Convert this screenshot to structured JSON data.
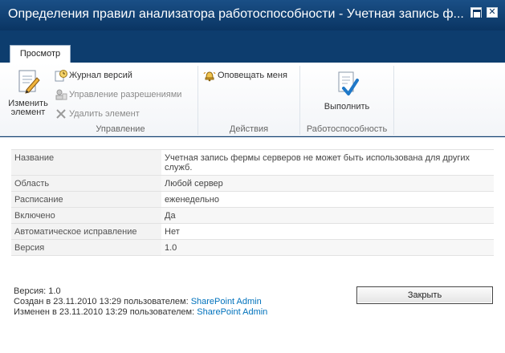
{
  "window": {
    "title": "Определения правил анализатора работоспособности - Учетная запись ф..."
  },
  "ribbon": {
    "tab_label": "Просмотр",
    "groups": {
      "manage": {
        "label": "Управление",
        "edit_item": "Изменить элемент",
        "version_history": "Журнал версий",
        "manage_permissions": "Управление разрешениями",
        "delete_item": "Удалить элемент"
      },
      "actions": {
        "label": "Действия",
        "alert_me": "Оповещать меня"
      },
      "health": {
        "label": "Работоспособность",
        "run": "Выполнить"
      }
    }
  },
  "properties": [
    {
      "key": "Название",
      "value": "Учетная запись фермы серверов не может быть использована для других служб."
    },
    {
      "key": "Область",
      "value": "Любой сервер"
    },
    {
      "key": "Расписание",
      "value": "еженедельно"
    },
    {
      "key": "Включено",
      "value": "Да"
    },
    {
      "key": "Автоматическое исправление",
      "value": "Нет"
    },
    {
      "key": "Версия",
      "value": "1.0"
    }
  ],
  "footer": {
    "version_line": "Версия: 1.0",
    "created_prefix": "Создан в 23.11.2010 13:29 пользователем:",
    "created_by": "SharePoint Admin",
    "modified_prefix": "Изменен в 23.11.2010 13:29 пользователем:",
    "modified_by": "SharePoint Admin",
    "close_label": "Закрыть"
  },
  "icons": {
    "edit_item": "edit-document-icon",
    "version_history": "history-icon",
    "manage_permissions": "permissions-icon",
    "delete_item": "delete-x-icon",
    "alert_me": "bell-icon",
    "run": "checkmark-document-icon"
  },
  "colors": {
    "titlebar": "#0d3d6e",
    "link": "#0072bc"
  }
}
